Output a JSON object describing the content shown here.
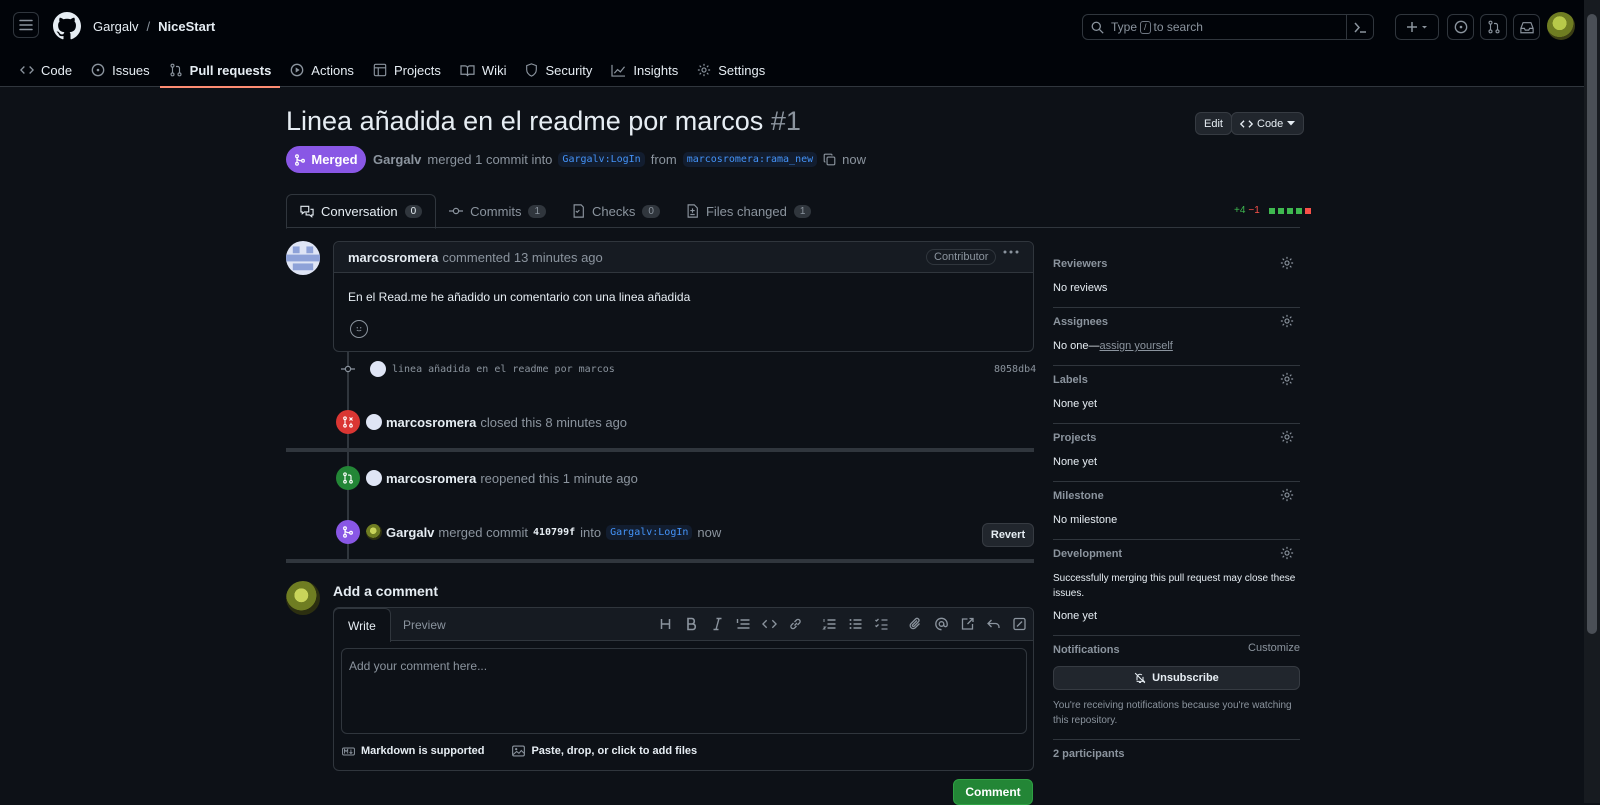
{
  "header": {
    "owner": "Gargalv",
    "separator": "/",
    "repo": "NiceStart",
    "search_prefix": "Type",
    "search_key": "/",
    "search_suffix": "to search"
  },
  "repo_tabs": [
    {
      "label": "Code",
      "icon": "code-icon"
    },
    {
      "label": "Issues",
      "icon": "issue-icon"
    },
    {
      "label": "Pull requests",
      "icon": "pull-request-icon"
    },
    {
      "label": "Actions",
      "icon": "play-icon"
    },
    {
      "label": "Projects",
      "icon": "table-icon"
    },
    {
      "label": "Wiki",
      "icon": "book-icon"
    },
    {
      "label": "Security",
      "icon": "shield-icon"
    },
    {
      "label": "Insights",
      "icon": "graph-icon"
    },
    {
      "label": "Settings",
      "icon": "gear-icon"
    }
  ],
  "pr": {
    "title": "Linea añadida en el readme por marcos",
    "number": "#1",
    "edit_label": "Edit",
    "code_label": "Code",
    "state": "Merged",
    "author": "Gargalv",
    "merged_text": "merged 1 commit into",
    "base_branch": "Gargalv:LogIn",
    "from_text": "from",
    "head_branch": "marcosromera:rama_new",
    "time": "now"
  },
  "pr_tabs": [
    {
      "label": "Conversation",
      "count": "0"
    },
    {
      "label": "Commits",
      "count": "1"
    },
    {
      "label": "Checks",
      "count": "0"
    },
    {
      "label": "Files changed",
      "count": "1"
    }
  ],
  "diffstat": {
    "added": "+4",
    "removed": "−1"
  },
  "comment": {
    "author": "marcosromera",
    "action": "commented 13 minutes ago",
    "badge": "Contributor",
    "body": "En el Read.me he añadido un comentario con una linea añadida"
  },
  "timeline": {
    "commit_message": "linea añadida en el readme por marcos",
    "commit_sha": "8058db4",
    "closed_user": "marcosromera",
    "closed_text": "closed this 8 minutes ago",
    "reopened_user": "marcosromera",
    "reopened_text": "reopened this 1 minute ago",
    "merged_user": "Gargalv",
    "merged_text": "merged commit",
    "merged_sha": "410799f",
    "merged_into": "into",
    "merged_branch": "Gargalv:LogIn",
    "merged_time": "now",
    "revert_label": "Revert"
  },
  "add_comment": {
    "title": "Add a comment",
    "write_tab": "Write",
    "preview_tab": "Preview",
    "placeholder": "Add your comment here...",
    "markdown_note": "Markdown is supported",
    "files_note": "Paste, drop, or click to add files",
    "submit_label": "Comment"
  },
  "sidebar": {
    "reviewers": {
      "title": "Reviewers",
      "value": "No reviews"
    },
    "assignees": {
      "title": "Assignees",
      "value": "No one—",
      "link": "assign yourself"
    },
    "labels": {
      "title": "Labels",
      "value": "None yet"
    },
    "projects": {
      "title": "Projects",
      "value": "None yet"
    },
    "milestone": {
      "title": "Milestone",
      "value": "No milestone"
    },
    "development": {
      "title": "Development",
      "note": "Successfully merging this pull request may close these issues.",
      "value": "None yet"
    },
    "notifications": {
      "title": "Notifications",
      "customize": "Customize",
      "button": "Unsubscribe",
      "note": "You're receiving notifications because you're watching this repository."
    },
    "participants": {
      "title": "2 participants"
    }
  },
  "colors": {
    "merged": "#8957e5",
    "closed": "#da3633",
    "open": "#238636",
    "accent_tab": "#fd8c73"
  }
}
